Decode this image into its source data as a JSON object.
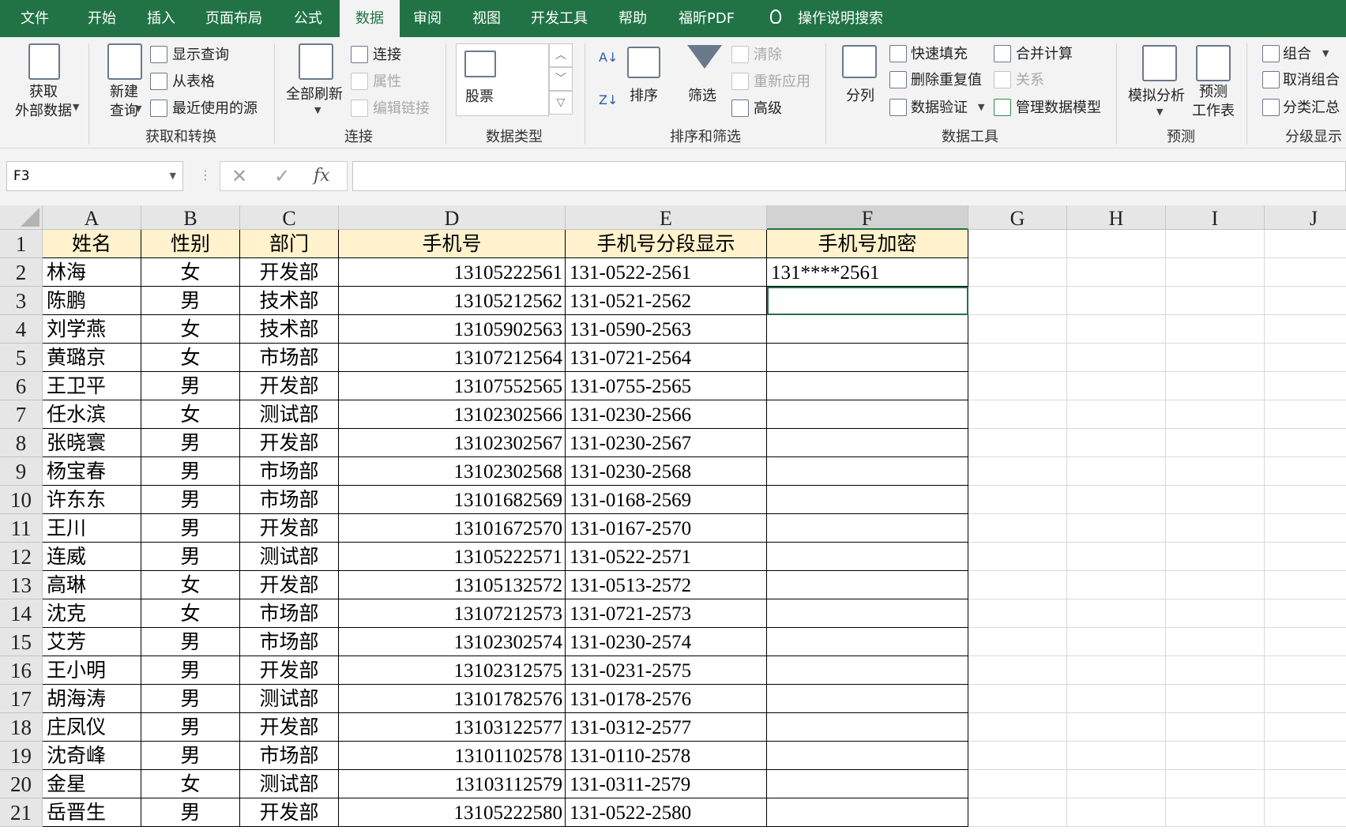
{
  "menu": {
    "tabs": [
      "文件",
      "开始",
      "插入",
      "页面布局",
      "公式",
      "数据",
      "审阅",
      "视图",
      "开发工具",
      "帮助",
      "福昕PDF"
    ],
    "active_tab": "数据",
    "tell_me": "操作说明搜索"
  },
  "ribbon": {
    "get_external": "获取\n外部数据",
    "new_query": "新建\n查询",
    "show_query": "显示查询",
    "from_table": "从表格",
    "recent_sources": "最近使用的源",
    "group_get_transform": "获取和转换",
    "refresh_all": "全部刷新",
    "connections": "连接",
    "properties": "属性",
    "edit_links": "编辑链接",
    "group_connections": "连接",
    "stock": "股票",
    "group_data_types": "数据类型",
    "sort": "排序",
    "filter": "筛选",
    "clear": "清除",
    "reapply": "重新应用",
    "advanced": "高级",
    "group_sort_filter": "排序和筛选",
    "text_to_columns": "分列",
    "flash_fill": "快速填充",
    "remove_duplicates": "删除重复值",
    "data_validation": "数据验证",
    "consolidate": "合并计算",
    "relationships": "关系",
    "manage_data_model": "管理数据模型",
    "group_data_tools": "数据工具",
    "what_if": "模拟分析",
    "forecast_sheet": "预测\n工作表",
    "group_forecast": "预测",
    "group_outline_item": "组合",
    "ungroup": "取消组合",
    "subtotal": "分类汇总",
    "group_outline": "分级显示"
  },
  "formula_bar": {
    "name_box": "F3",
    "cancel": "✕",
    "enter": "✓",
    "fx": "fx",
    "formula": ""
  },
  "sheet": {
    "columns": [
      "A",
      "B",
      "C",
      "D",
      "E",
      "F",
      "G",
      "H",
      "I",
      "J"
    ],
    "selected_column": "F",
    "row_numbers": [
      "1",
      "2",
      "3",
      "4",
      "5",
      "6",
      "7",
      "8",
      "9",
      "10",
      "11",
      "12",
      "13",
      "14",
      "15",
      "16",
      "17",
      "18",
      "19",
      "20",
      "21"
    ],
    "header": [
      "姓名",
      "性别",
      "部门",
      "手机号",
      "手机号分段显示",
      "手机号加密"
    ],
    "rows": [
      [
        "林海",
        "女",
        "开发部",
        "13105222561",
        "131-0522-2561",
        "131****2561"
      ],
      [
        "陈鹏",
        "男",
        "技术部",
        "13105212562",
        "131-0521-2562",
        ""
      ],
      [
        "刘学燕",
        "女",
        "技术部",
        "13105902563",
        "131-0590-2563",
        ""
      ],
      [
        "黄璐京",
        "女",
        "市场部",
        "13107212564",
        "131-0721-2564",
        ""
      ],
      [
        "王卫平",
        "男",
        "开发部",
        "13107552565",
        "131-0755-2565",
        ""
      ],
      [
        "任水滨",
        "女",
        "测试部",
        "13102302566",
        "131-0230-2566",
        ""
      ],
      [
        "张晓寰",
        "男",
        "开发部",
        "13102302567",
        "131-0230-2567",
        ""
      ],
      [
        "杨宝春",
        "男",
        "市场部",
        "13102302568",
        "131-0230-2568",
        ""
      ],
      [
        "许东东",
        "男",
        "市场部",
        "13101682569",
        "131-0168-2569",
        ""
      ],
      [
        "王川",
        "男",
        "开发部",
        "13101672570",
        "131-0167-2570",
        ""
      ],
      [
        "连威",
        "男",
        "测试部",
        "13105222571",
        "131-0522-2571",
        ""
      ],
      [
        "高琳",
        "女",
        "开发部",
        "13105132572",
        "131-0513-2572",
        ""
      ],
      [
        "沈克",
        "女",
        "市场部",
        "13107212573",
        "131-0721-2573",
        ""
      ],
      [
        "艾芳",
        "男",
        "市场部",
        "13102302574",
        "131-0230-2574",
        ""
      ],
      [
        "王小明",
        "男",
        "开发部",
        "13102312575",
        "131-0231-2575",
        ""
      ],
      [
        "胡海涛",
        "男",
        "测试部",
        "13101782576",
        "131-0178-2576",
        ""
      ],
      [
        "庄凤仪",
        "男",
        "开发部",
        "13103122577",
        "131-0312-2577",
        ""
      ],
      [
        "沈奇峰",
        "男",
        "市场部",
        "13101102578",
        "131-0110-2578",
        ""
      ],
      [
        "金星",
        "女",
        "测试部",
        "13103112579",
        "131-0311-2579",
        ""
      ],
      [
        "岳晋生",
        "男",
        "开发部",
        "13105222580",
        "131-0522-2580",
        ""
      ]
    ]
  }
}
